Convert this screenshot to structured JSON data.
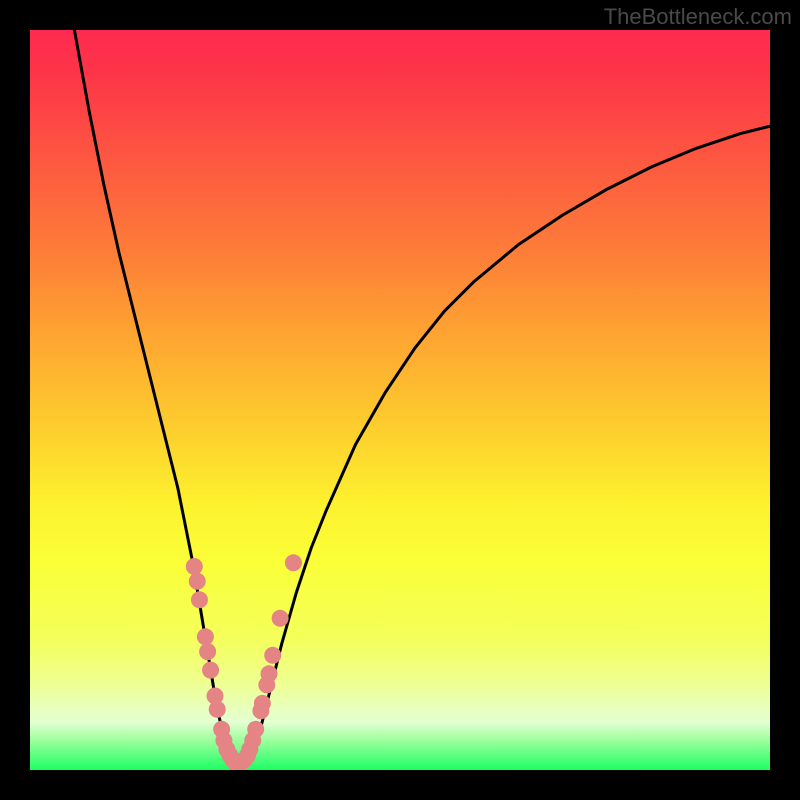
{
  "watermark": "TheBottleneck.com",
  "colors": {
    "background": "#000000",
    "curve": "#000000",
    "marker_fill": "#e58484",
    "marker_stroke": "#d06060",
    "watermark_text": "#4a4a4a"
  },
  "chart_data": {
    "type": "line",
    "title": "",
    "xlabel": "",
    "ylabel": "",
    "xlim": [
      0,
      100
    ],
    "ylim": [
      0,
      100
    ],
    "grid": false,
    "series": [
      {
        "name": "bottleneck-curve",
        "x": [
          6,
          8,
          10,
          12,
          14,
          16,
          18,
          20,
          22,
          23,
          24,
          25,
          26,
          27,
          28,
          29,
          30,
          31,
          32,
          34,
          36,
          38,
          40,
          44,
          48,
          52,
          56,
          60,
          66,
          72,
          78,
          84,
          90,
          96,
          100
        ],
        "values": [
          100,
          89,
          79,
          70,
          62,
          54,
          46,
          38,
          28,
          22,
          16,
          10,
          5,
          2,
          1,
          1,
          2,
          5,
          9,
          17,
          24,
          30,
          35,
          44,
          51,
          57,
          62,
          66,
          71,
          75,
          78.5,
          81.5,
          84,
          86,
          87
        ]
      }
    ],
    "markers": {
      "name": "highlighted-points",
      "points": [
        {
          "x": 22.2,
          "y": 27.5
        },
        {
          "x": 22.6,
          "y": 25.5
        },
        {
          "x": 22.9,
          "y": 23.0
        },
        {
          "x": 23.7,
          "y": 18.0
        },
        {
          "x": 24.0,
          "y": 16.0
        },
        {
          "x": 24.4,
          "y": 13.5
        },
        {
          "x": 25.0,
          "y": 10.0
        },
        {
          "x": 25.3,
          "y": 8.2
        },
        {
          "x": 25.9,
          "y": 5.5
        },
        {
          "x": 26.2,
          "y": 4.0
        },
        {
          "x": 26.6,
          "y": 2.8
        },
        {
          "x": 27.0,
          "y": 2.0
        },
        {
          "x": 27.4,
          "y": 1.4
        },
        {
          "x": 27.8,
          "y": 1.0
        },
        {
          "x": 28.2,
          "y": 1.0
        },
        {
          "x": 28.6,
          "y": 1.1
        },
        {
          "x": 29.0,
          "y": 1.4
        },
        {
          "x": 29.4,
          "y": 2.0
        },
        {
          "x": 29.7,
          "y": 2.8
        },
        {
          "x": 30.1,
          "y": 4.0
        },
        {
          "x": 30.5,
          "y": 5.5
        },
        {
          "x": 31.2,
          "y": 8.0
        },
        {
          "x": 31.4,
          "y": 9.0
        },
        {
          "x": 32.0,
          "y": 11.5
        },
        {
          "x": 32.3,
          "y": 13.0
        },
        {
          "x": 32.8,
          "y": 15.5
        },
        {
          "x": 33.8,
          "y": 20.5
        },
        {
          "x": 35.6,
          "y": 28.0
        }
      ]
    }
  }
}
